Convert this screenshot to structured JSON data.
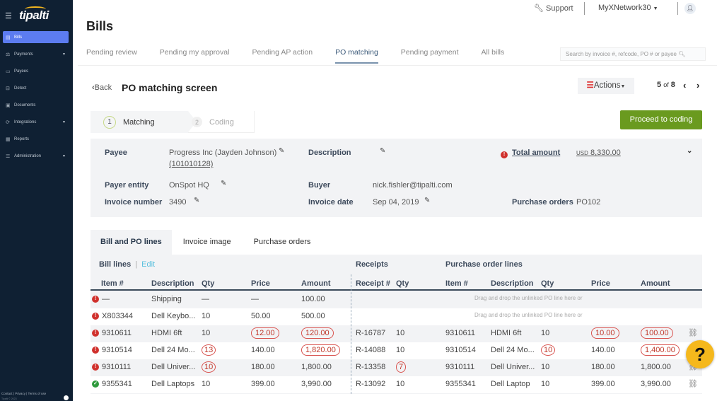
{
  "sidebar": {
    "logo": "tipalti",
    "items": [
      {
        "label": "Bills",
        "icon": "bills-icon",
        "active": true,
        "caret": false
      },
      {
        "label": "Payments",
        "icon": "payments-icon",
        "active": false,
        "caret": true
      },
      {
        "label": "Payees",
        "icon": "payees-icon",
        "active": false,
        "caret": false
      },
      {
        "label": "Detect",
        "icon": "detect-icon",
        "active": false,
        "caret": false
      },
      {
        "label": "Documents",
        "icon": "documents-icon",
        "active": false,
        "caret": false
      },
      {
        "label": "Integrations",
        "icon": "integrations-icon",
        "active": false,
        "caret": true
      },
      {
        "label": "Reports",
        "icon": "reports-icon",
        "active": false,
        "caret": false
      },
      {
        "label": "Administration",
        "icon": "administration-icon",
        "active": false,
        "caret": true
      }
    ],
    "footer": {
      "contact": "Contact",
      "privacy": "Privacy",
      "terms": "Terms of use",
      "copyright": "Tipalti © 2023"
    }
  },
  "topbar": {
    "support": "Support",
    "network": "MyXNetwork30"
  },
  "page": {
    "title": "Bills"
  },
  "tabs": [
    "Pending review",
    "Pending my approval",
    "Pending AP action",
    "PO matching",
    "Pending payment",
    "All bills"
  ],
  "active_tab": "PO matching",
  "search": {
    "placeholder": "Search by invoice #, refcode, PO # or payee"
  },
  "screen": {
    "back": "Back",
    "title": "PO matching screen",
    "actions": "Actions",
    "pager": {
      "current": "5",
      "of": "of",
      "total": "8"
    }
  },
  "steps": [
    {
      "num": "1",
      "label": "Matching"
    },
    {
      "num": "2",
      "label": "Coding"
    }
  ],
  "proceed": "Proceed to coding",
  "info": {
    "payee_label": "Payee",
    "payee_value": "Progress Inc (Jayden Johnson)",
    "payee_id": "(101010128)",
    "description_label": "Description",
    "total_label": "Total amount",
    "total_currency": "USD",
    "total_value": "8,330.00",
    "payer_label": "Payer entity",
    "payer_value": "OnSpot HQ",
    "buyer_label": "Buyer",
    "buyer_value": "nick.fishler@tipalti.com",
    "invoice_number_label": "Invoice number",
    "invoice_number_value": "3490",
    "invoice_date_label": "Invoice date",
    "invoice_date_value": "Sep 04, 2019",
    "po_label": "Purchase orders",
    "po_value": "PO102"
  },
  "table_tabs": [
    "Bill and PO lines",
    "Invoice image",
    "Purchase orders"
  ],
  "table": {
    "bill_lines": "Bill lines",
    "edit": "Edit",
    "receipts": "Receipts",
    "po_lines": "Purchase order lines",
    "headers": {
      "item": "Item #",
      "description": "Description",
      "qty": "Qty",
      "price": "Price",
      "amount": "Amount",
      "receipt": "Receipt #",
      "rqty": "Qty",
      "po_item": "Item #",
      "po_description": "Description",
      "po_qty": "Qty",
      "po_price": "Price",
      "po_amount": "Amount"
    },
    "drag_text": "Drag and drop the unlinked PO line here or",
    "rows": [
      {
        "status": "error",
        "item": "—",
        "desc": "Shipping",
        "qty": "—",
        "price": "—",
        "amount": "100.00",
        "receipt": "",
        "rqty": "",
        "po_item": "",
        "po_desc": "",
        "po_qty": "",
        "po_price": "",
        "po_amount": ""
      },
      {
        "status": "error",
        "item": "X803344",
        "desc": "Dell Keybo...",
        "qty": "10",
        "price": "50.00",
        "amount": "500.00",
        "receipt": "",
        "rqty": "",
        "po_item": "",
        "po_desc": "",
        "po_qty": "",
        "po_price": "",
        "po_amount": ""
      },
      {
        "status": "error",
        "item": "9310611",
        "desc": "HDMI 6ft",
        "qty": "10",
        "price": "12.00",
        "amount": "120.00",
        "receipt": "R-16787",
        "rqty": "10",
        "po_item": "9310611",
        "po_desc": "HDMI 6ft",
        "po_qty": "10",
        "po_price": "10.00",
        "po_amount": "100.00"
      },
      {
        "status": "error",
        "item": "9310514",
        "desc": "Dell 24 Mo...",
        "qty": "13",
        "price": "140.00",
        "amount": "1,820.00",
        "receipt": "R-14088",
        "rqty": "10",
        "po_item": "9310514",
        "po_desc": "Dell 24 Mo...",
        "po_qty": "10",
        "po_price": "140.00",
        "po_amount": "1,400.00"
      },
      {
        "status": "error",
        "item": "9310111",
        "desc": "Dell Univer...",
        "qty": "10",
        "price": "180.00",
        "amount": "1,800.00",
        "receipt": "R-13358",
        "rqty": "7",
        "po_item": "9310111",
        "po_desc": "Dell Univer...",
        "po_qty": "10",
        "po_price": "180.00",
        "po_amount": "1,800.00"
      },
      {
        "status": "ok",
        "item": "9355341",
        "desc": "Dell Laptops",
        "qty": "10",
        "price": "399.00",
        "amount": "3,990.00",
        "receipt": "R-13092",
        "rqty": "10",
        "po_item": "9355341",
        "po_desc": "Dell Laptop",
        "po_qty": "10",
        "po_price": "399.00",
        "po_amount": "3,990.00"
      }
    ]
  },
  "help": "?"
}
